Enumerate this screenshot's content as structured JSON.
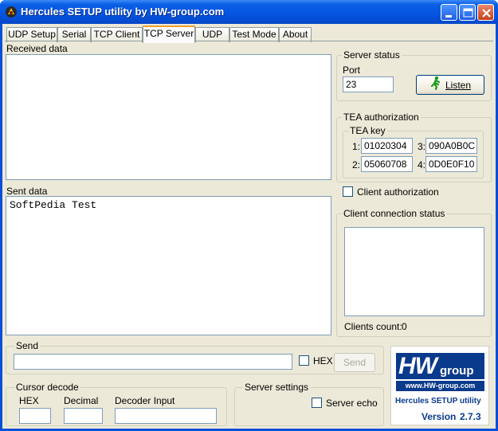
{
  "window": {
    "title": "Hercules SETUP utility by HW-group.com"
  },
  "tabs": [
    "UDP Setup",
    "Serial",
    "TCP Client",
    "TCP Server",
    "UDP",
    "Test Mode",
    "About"
  ],
  "active_tab": "TCP Server",
  "received": {
    "label": "Received data",
    "content": ""
  },
  "sent": {
    "label": "Sent data",
    "content": "SoftPedia Test"
  },
  "server_status": {
    "title": "Server status",
    "port_label": "Port",
    "port_value": "23",
    "listen_label": "Listen"
  },
  "tea": {
    "title": "TEA authorization",
    "key_title": "TEA key",
    "keys": [
      {
        "num": "1:",
        "value": "01020304"
      },
      {
        "num": "2:",
        "value": "05060708"
      },
      {
        "num": "3:",
        "value": "090A0B0C"
      },
      {
        "num": "4:",
        "value": "0D0E0F10"
      }
    ],
    "client_auth_label": "Client authorization"
  },
  "client_connection": {
    "title": "Client connection status",
    "count_label": "Clients count:",
    "count_value": "0"
  },
  "send": {
    "title": "Send",
    "value": "",
    "hex_label": "HEX",
    "button_label": "Send"
  },
  "cursor_decode": {
    "title": "Cursor decode",
    "hex_label": "HEX",
    "decimal_label": "Decimal",
    "decoder_label": "Decoder Input"
  },
  "server_settings": {
    "title": "Server settings",
    "echo_label": "Server echo"
  },
  "logo": {
    "hw": "HW",
    "group": "group",
    "url": "www.HW-group.com",
    "product": "Hercules SETUP utility",
    "version_label": "Version",
    "version": "2.7.3"
  },
  "colors": {
    "title_bar": "#0554e0",
    "dialog_bg": "#ece9d8",
    "logo_blue": "#0a3a8c",
    "tab_highlight": "#f0a02a"
  }
}
